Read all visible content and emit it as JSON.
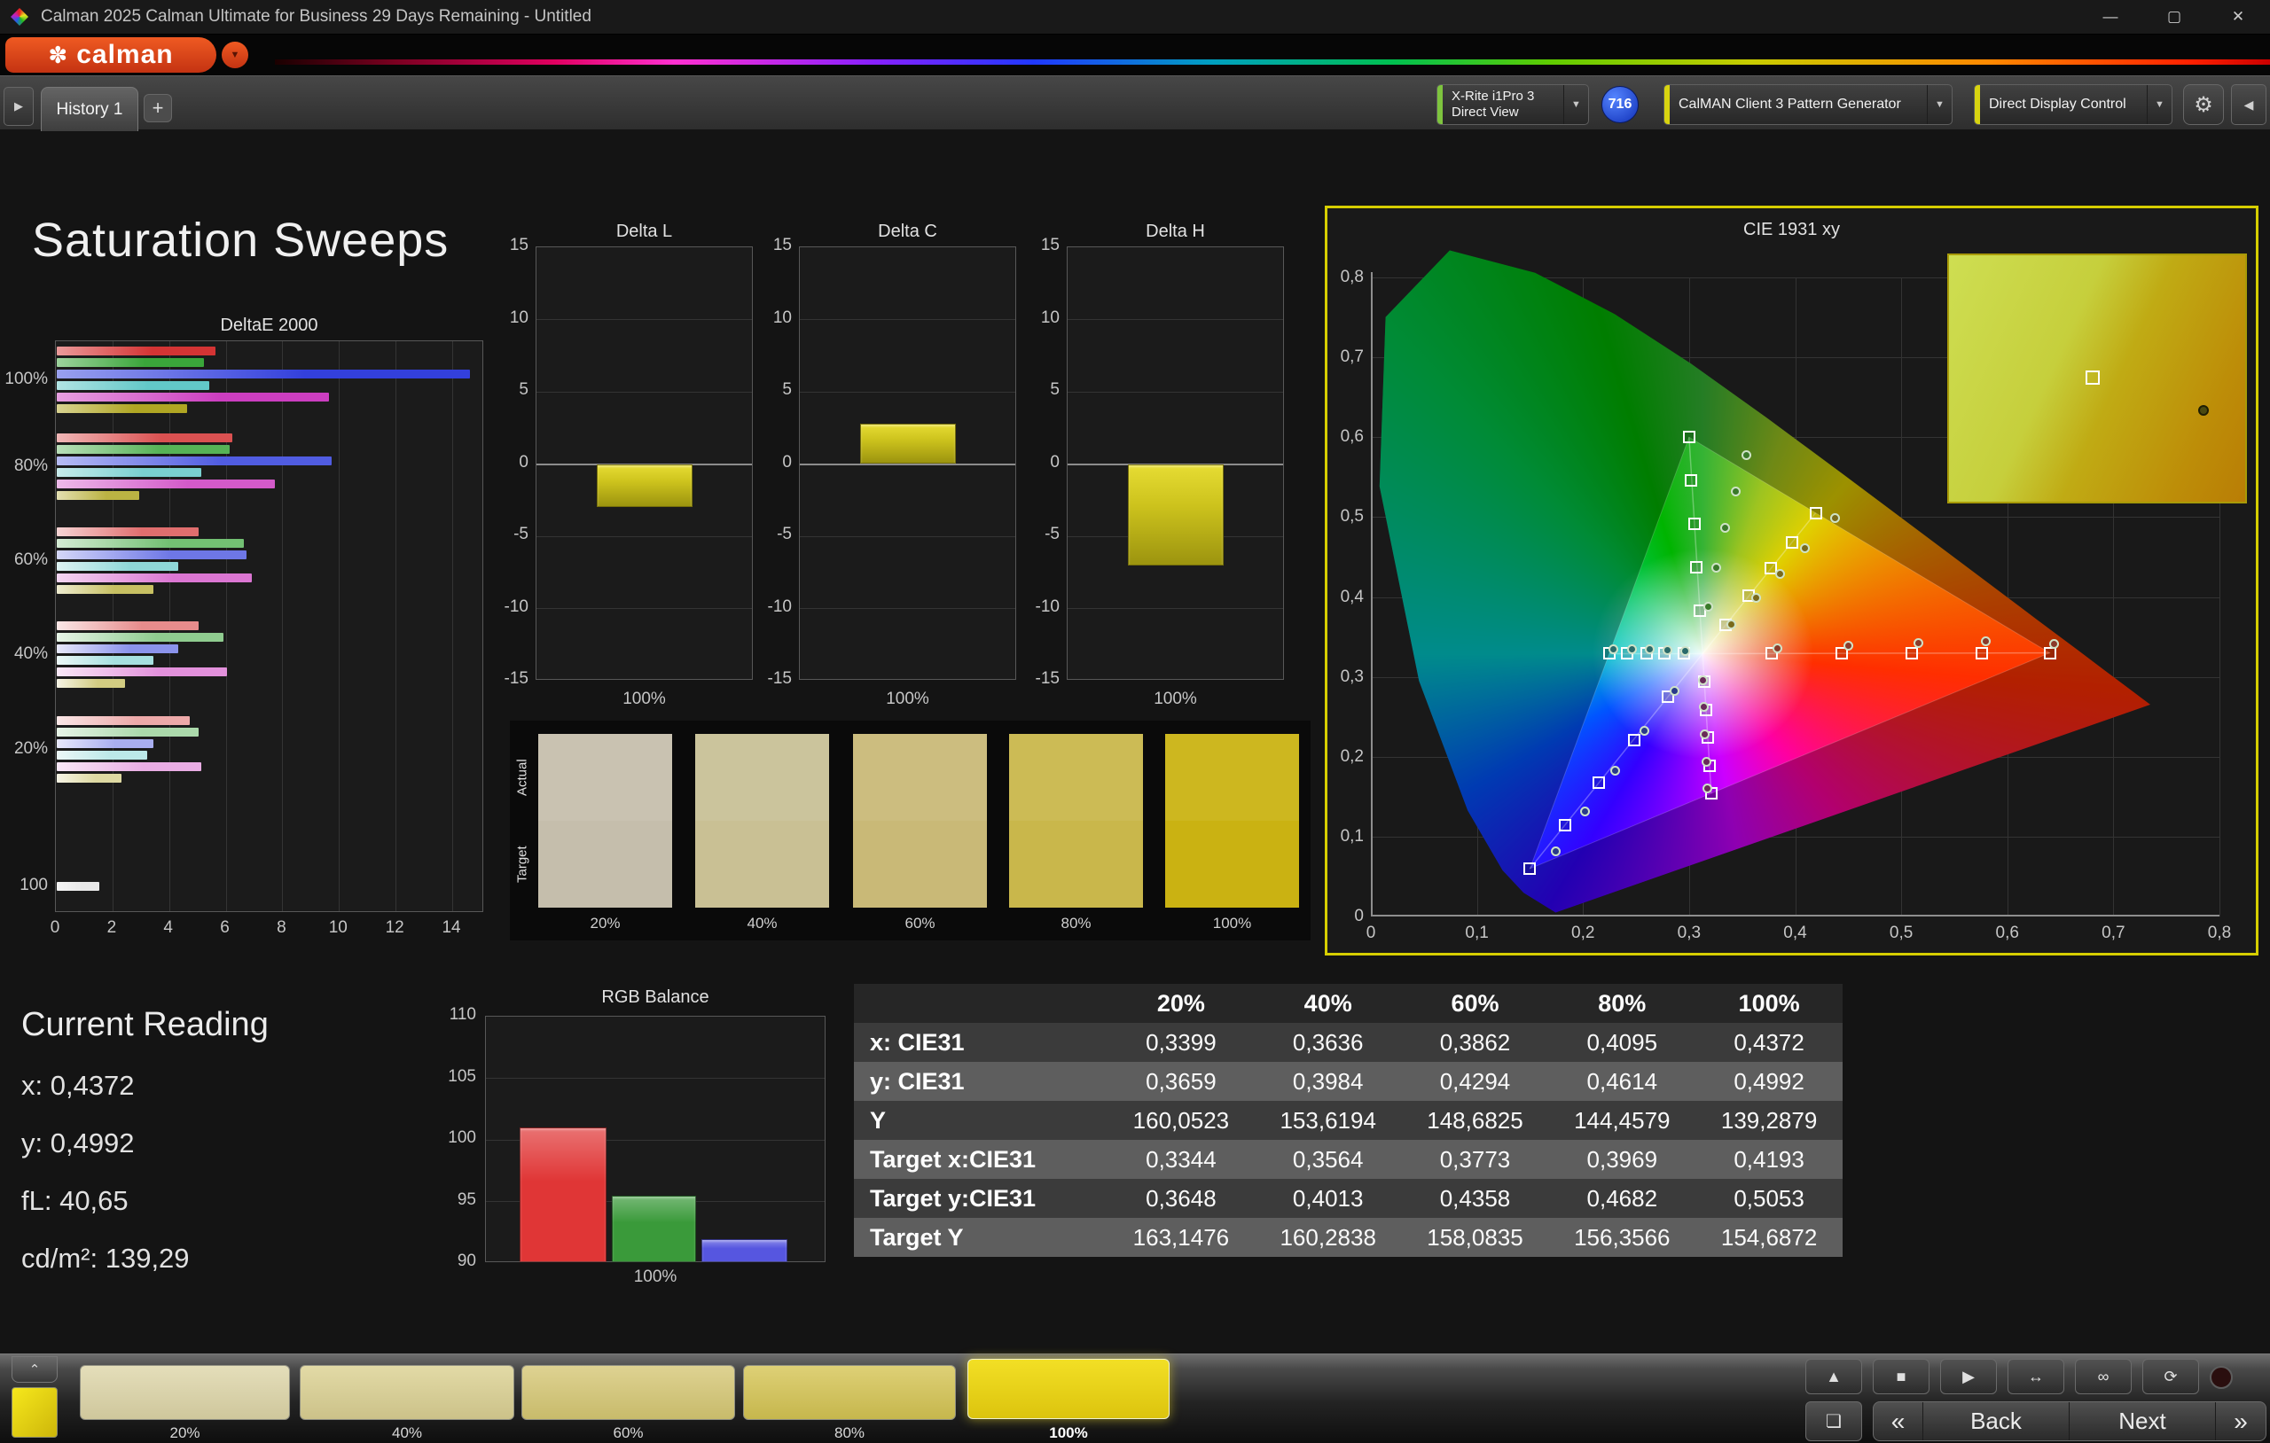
{
  "window": {
    "title": "Calman 2025 Calman Ultimate for Business 29 Days Remaining  - Untitled"
  },
  "brand": {
    "name": "calman"
  },
  "nav": {
    "tab": "History 1",
    "meter_line1": "X-Rite i1Pro 3",
    "meter_line2": "Direct View",
    "badge": "716",
    "pattern_generator": "CalMAN Client 3 Pattern Generator",
    "display_control": "Direct Display Control"
  },
  "icons": {
    "minimize": "—",
    "maximize": "▢",
    "close": "✕",
    "caret_down": "▼",
    "flower": "✽",
    "plus": "+",
    "expand_right": "▶",
    "collapse_left": "◀",
    "gear": "⚙",
    "eject": "▲",
    "stop": "■",
    "play": "▶",
    "fit": "↔",
    "infinity": "∞",
    "loop": "⟳",
    "record": "●",
    "pattern_window": "❏",
    "handle_up": "⌃",
    "chevron_left": "«",
    "chevron_right": "»"
  },
  "page_title": "Saturation Sweeps",
  "current_reading": {
    "title": "Current Reading",
    "lines": [
      "x: 0,4372",
      "y: 0,4992",
      "fL: 40,65",
      "cd/m²: 139,29"
    ]
  },
  "swatch_panel": {
    "row_labels": [
      "Actual",
      "Target"
    ],
    "labels": [
      "20%",
      "40%",
      "60%",
      "80%",
      "100%"
    ],
    "actual": [
      "#c9c2b1",
      "#cbc49c",
      "#ccbd7f",
      "#ccbb55",
      "#cdb71f"
    ],
    "target": [
      "#c5beac",
      "#c9c094",
      "#c9b977",
      "#c9b74b",
      "#cab212"
    ]
  },
  "chart_data": [
    {
      "id": "deltae2000",
      "type": "bar",
      "orientation": "horizontal",
      "title": "DeltaE 2000",
      "xlim": [
        0,
        15.1
      ],
      "xticks": [
        0,
        2,
        4,
        6,
        8,
        10,
        12,
        14
      ],
      "series": [
        "Red",
        "Green",
        "Blue",
        "Cyan",
        "Magenta",
        "Yellow"
      ],
      "series_colors": [
        "#d43434",
        "#3aa63a",
        "#3340dc",
        "#62c8c8",
        "#cc3ec0",
        "#b0a623"
      ],
      "groups": [
        {
          "label": "100%",
          "values": [
            5.6,
            5.2,
            14.6,
            5.4,
            9.6,
            4.6
          ]
        },
        {
          "label": "80%",
          "values": [
            6.2,
            6.1,
            9.7,
            5.1,
            7.7,
            2.9
          ]
        },
        {
          "label": "60%",
          "values": [
            5.0,
            6.6,
            6.7,
            4.3,
            6.9,
            3.4
          ]
        },
        {
          "label": "40%",
          "values": [
            5.0,
            5.9,
            4.3,
            3.4,
            6.0,
            2.4
          ]
        },
        {
          "label": "20%",
          "values": [
            4.7,
            5.0,
            3.4,
            3.2,
            5.1,
            2.3
          ]
        },
        {
          "label": "100",
          "values": [
            1.5
          ],
          "colors": [
            "#e8e8e8"
          ]
        }
      ]
    },
    {
      "id": "delta_l",
      "type": "bar",
      "title": "Delta L",
      "xlabel": "100%",
      "ylim": [
        -15,
        15
      ],
      "yticks": [
        15,
        10,
        5,
        0,
        -5,
        -10,
        -15
      ],
      "value": -3.0
    },
    {
      "id": "delta_c",
      "type": "bar",
      "title": "Delta C",
      "xlabel": "100%",
      "ylim": [
        -15,
        15
      ],
      "yticks": [
        15,
        10,
        5,
        0,
        -5,
        -10,
        -15
      ],
      "value": 2.8
    },
    {
      "id": "delta_h",
      "type": "bar",
      "title": "Delta H",
      "xlabel": "100%",
      "ylim": [
        -15,
        15
      ],
      "yticks": [
        15,
        10,
        5,
        0,
        -5,
        -10,
        -15
      ],
      "value": -7.0
    },
    {
      "id": "rgb_balance",
      "type": "bar",
      "title": "RGB Balance",
      "xlabel": "100%",
      "categories": [
        "Red",
        "Green",
        "Blue"
      ],
      "values": [
        100.9,
        95.4,
        91.9
      ],
      "colors": [
        "#e03636",
        "#3a9a3a",
        "#5656e0"
      ],
      "ylim": [
        90,
        110
      ],
      "yticks": [
        110,
        105,
        100,
        95,
        90
      ]
    },
    {
      "id": "cie1931",
      "type": "scatter",
      "title": "CIE 1931 xy",
      "xticks": [
        "0",
        "0,1",
        "0,2",
        "0,3",
        "0,4",
        "0,5",
        "0,6",
        "0,7",
        "0,8"
      ],
      "yticks": [
        "0,8",
        "0,7",
        "0,6",
        "0,5",
        "0,4",
        "0,3",
        "0,2",
        "0,1",
        "0"
      ],
      "white_point": {
        "x": 0.3127,
        "y": 0.329
      },
      "gamut_triangle": [
        {
          "x": 0.64,
          "y": 0.33
        },
        {
          "x": 0.3,
          "y": 0.6
        },
        {
          "x": 0.15,
          "y": 0.06
        }
      ],
      "sweeps": [
        {
          "name": "red",
          "dot_color": "#8a3a2a",
          "targets": [
            [
              0.378,
              0.33
            ],
            [
              0.444,
              0.33
            ],
            [
              0.51,
              0.33
            ],
            [
              0.576,
              0.33
            ],
            [
              0.64,
              0.33
            ]
          ],
          "measured": [
            [
              0.383,
              0.336
            ],
            [
              0.45,
              0.339
            ],
            [
              0.516,
              0.342
            ],
            [
              0.58,
              0.344
            ],
            [
              0.644,
              0.341
            ]
          ]
        },
        {
          "name": "green",
          "dot_color": "#3a7a2a",
          "targets": [
            [
              0.31,
              0.383
            ],
            [
              0.307,
              0.437
            ],
            [
              0.305,
              0.492
            ],
            [
              0.302,
              0.546
            ],
            [
              0.3,
              0.6
            ]
          ],
          "measured": [
            [
              0.318,
              0.388
            ],
            [
              0.326,
              0.437
            ],
            [
              0.334,
              0.487
            ],
            [
              0.344,
              0.532
            ],
            [
              0.354,
              0.577
            ]
          ]
        },
        {
          "name": "blue",
          "dot_color": "#2a3a8a",
          "targets": [
            [
              0.28,
              0.275
            ],
            [
              0.248,
              0.221
            ],
            [
              0.215,
              0.167
            ],
            [
              0.183,
              0.114
            ],
            [
              0.15,
              0.06
            ]
          ],
          "measured": [
            [
              0.286,
              0.282
            ],
            [
              0.258,
              0.232
            ],
            [
              0.23,
              0.182
            ],
            [
              0.202,
              0.132
            ],
            [
              0.174,
              0.082
            ]
          ]
        },
        {
          "name": "cyan",
          "dot_color": "#2a6a6a",
          "targets": [
            [
              0.295,
              0.329
            ],
            [
              0.277,
              0.329
            ],
            [
              0.26,
              0.329
            ],
            [
              0.242,
              0.329
            ],
            [
              0.225,
              0.329
            ]
          ],
          "measured": [
            [
              0.296,
              0.332
            ],
            [
              0.28,
              0.333
            ],
            [
              0.263,
              0.334
            ],
            [
              0.246,
              0.334
            ],
            [
              0.229,
              0.335
            ]
          ]
        },
        {
          "name": "magenta",
          "dot_color": "#6a2a5a",
          "targets": [
            [
              0.3143,
              0.294
            ],
            [
              0.316,
              0.259
            ],
            [
              0.3176,
              0.224
            ],
            [
              0.3193,
              0.189
            ],
            [
              0.3209,
              0.154
            ]
          ],
          "measured": [
            [
              0.313,
              0.296
            ],
            [
              0.314,
              0.262
            ],
            [
              0.315,
              0.228
            ],
            [
              0.316,
              0.194
            ],
            [
              0.317,
              0.16
            ]
          ]
        },
        {
          "name": "yellow",
          "dot_color": "#7a6a1a",
          "targets": [
            [
              0.3344,
              0.3648
            ],
            [
              0.3564,
              0.4013
            ],
            [
              0.3773,
              0.4358
            ],
            [
              0.3969,
              0.4682
            ],
            [
              0.4193,
              0.5053
            ]
          ],
          "measured": [
            [
              0.3399,
              0.3659
            ],
            [
              0.3636,
              0.3984
            ],
            [
              0.3862,
              0.4294
            ],
            [
              0.4095,
              0.4614
            ],
            [
              0.4372,
              0.4992
            ]
          ]
        }
      ],
      "inset": {
        "square": {
          "x": 48,
          "y": 49
        },
        "dot": {
          "x": 85,
          "y": 62
        }
      }
    },
    {
      "id": "results_table",
      "type": "table",
      "columns": [
        "20%",
        "40%",
        "60%",
        "80%",
        "100%"
      ],
      "rows": [
        {
          "label": "x: CIE31",
          "values": [
            "0,3399",
            "0,3636",
            "0,3862",
            "0,4095",
            "0,4372"
          ]
        },
        {
          "label": "y: CIE31",
          "values": [
            "0,3659",
            "0,3984",
            "0,4294",
            "0,4614",
            "0,4992"
          ]
        },
        {
          "label": "Y",
          "values": [
            "160,0523",
            "153,6194",
            "148,6825",
            "144,4579",
            "139,2879"
          ]
        },
        {
          "label": "Target x:CIE31",
          "values": [
            "0,3344",
            "0,3564",
            "0,3773",
            "0,3969",
            "0,4193"
          ]
        },
        {
          "label": "Target y:CIE31",
          "values": [
            "0,3648",
            "0,4013",
            "0,4358",
            "0,4682",
            "0,5053"
          ]
        },
        {
          "label": "Target Y",
          "values": [
            "163,1476",
            "160,2838",
            "158,0835",
            "156,3566",
            "154,6872"
          ]
        }
      ]
    }
  ],
  "bottom_bar": {
    "chips": [
      {
        "label": "20%",
        "top": "#e4deba",
        "bottom": "#cfc79c",
        "selected": false
      },
      {
        "label": "40%",
        "top": "#e2daa6",
        "bottom": "#ccc289",
        "selected": false
      },
      {
        "label": "60%",
        "top": "#ded292",
        "bottom": "#c8bb6b",
        "selected": false
      },
      {
        "label": "80%",
        "top": "#ded076",
        "bottom": "#c6b74d",
        "selected": false
      },
      {
        "label": "100%",
        "top": "#f2df25",
        "bottom": "#dcc40e",
        "selected": true
      }
    ],
    "back": "Back",
    "next": "Next",
    "prev_chevron": "«",
    "next_chevron": "»"
  }
}
